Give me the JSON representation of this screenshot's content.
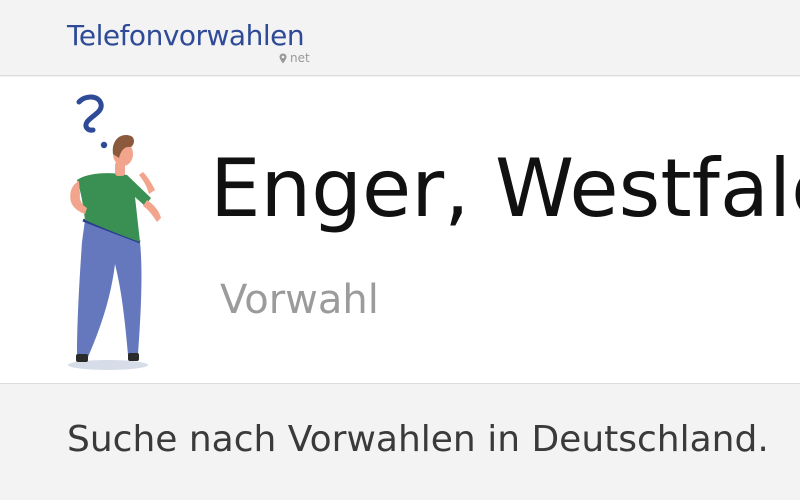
{
  "header": {
    "logo_text": "Telefonvorwahlen",
    "logo_tld": "net",
    "brand_color": "#2f4b98",
    "logo_icon": "map-pin-icon"
  },
  "hero": {
    "title": "Enger, Westfalen",
    "subtitle": "Vorwahl",
    "illustration": "thinking-person-with-question-mark"
  },
  "footer_band": {
    "tagline": "Suche nach Vorwahlen in Deutschland."
  }
}
